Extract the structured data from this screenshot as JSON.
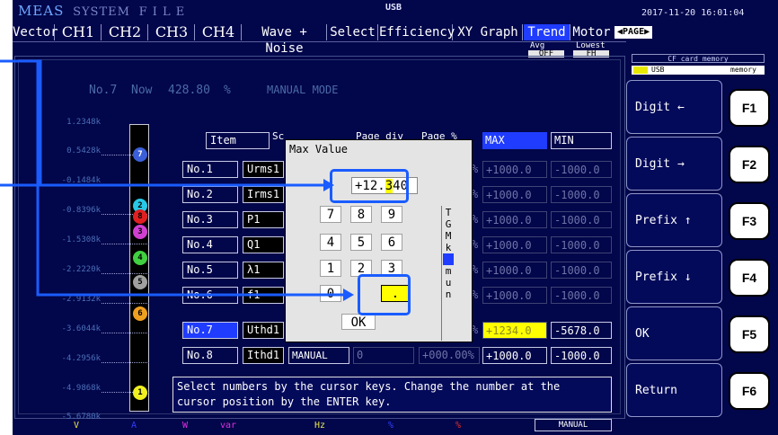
{
  "topbar": {
    "mode_meas": "MEAS",
    "mode_system": "SYSTEM",
    "mode_file": "F I L E",
    "usb": "USB",
    "datetime": "2017-11-20 16:01:04"
  },
  "tabs": [
    {
      "label": "Vector"
    },
    {
      "label": "CH1"
    },
    {
      "label": "CH2"
    },
    {
      "label": "CH3"
    },
    {
      "label": "CH4"
    },
    {
      "label": "Wave + Noise"
    },
    {
      "label": "Select"
    },
    {
      "label": "Efficiency"
    },
    {
      "label": "XY Graph"
    },
    {
      "label": "Trend"
    },
    {
      "label": "Motor"
    }
  ],
  "page_button": "◀PAGE▶",
  "sub_labels": {
    "avg": "Avg",
    "lowest": "Lowest",
    "avg_val": "OFF",
    "low_val": "FH"
  },
  "memory": {
    "cf": "CF card memory",
    "usb": "USB",
    "usb_memory": "memory"
  },
  "status": {
    "no": "No.7",
    "now": "Now",
    "value": "428.80",
    "unit": "%",
    "mode": "MANUAL MODE"
  },
  "scale_labels": [
    "1.2348k",
    "0.5428k",
    "-0.1484k",
    "-0.8396k",
    "-1.5308k",
    "-2.2220k",
    "-2.9132k",
    "-3.6044k",
    "-4.2956k",
    "-4.9868k",
    "-5.6780k"
  ],
  "channels": [
    "7",
    "2",
    "8",
    "3",
    "4",
    "5",
    "6",
    "1"
  ],
  "table": {
    "headers": {
      "item": "Item",
      "scale": "Scale",
      "page_div": "Page div",
      "page_pct": "Page %",
      "max": "MAX",
      "min": "MIN"
    },
    "rows": [
      {
        "no": "No.1",
        "item": "Urms1",
        "max": "+1000.0",
        "min": "-1000.0"
      },
      {
        "no": "No.2",
        "item": "Irms1",
        "max": "+1000.0",
        "min": "-1000.0"
      },
      {
        "no": "No.3",
        "item": "P1",
        "max": "+1000.0",
        "min": "-1000.0"
      },
      {
        "no": "No.4",
        "item": "Q1",
        "max": "+1000.0",
        "min": "-1000.0"
      },
      {
        "no": "No.5",
        "item": "λ1",
        "max": "+1000.0",
        "min": "-1000.0"
      },
      {
        "no": "No.6",
        "item": "f1",
        "max": "+1000.0",
        "min": "-1000.0"
      },
      {
        "no": "No.7",
        "item": "Uthd1",
        "max": "+1234.0",
        "min": "-5678.0"
      },
      {
        "no": "No.8",
        "item": "Ithd1",
        "scale": "MANUAL",
        "page_div": "0",
        "page_pct": "+000.00%",
        "max": "+1000.0",
        "min": "-1000.0"
      }
    ]
  },
  "popup": {
    "title": "Max Value",
    "value_prefix": "+12.",
    "value_cursor": "3",
    "value_suffix": "40",
    "keys": [
      "7",
      "8",
      "9",
      "4",
      "5",
      "6",
      "1",
      "2",
      "3",
      "0",
      "."
    ],
    "ok": "OK",
    "prefixes": [
      "T",
      "G",
      "M",
      "k",
      "",
      "m",
      "u",
      "n"
    ]
  },
  "help": {
    "line1": "Select numbers by the cursor keys. Change the number at the",
    "line2": "cursor position by the ENTER key."
  },
  "function_keys": [
    {
      "key": "F1",
      "label": "Digit ←"
    },
    {
      "key": "F2",
      "label": "Digit →"
    },
    {
      "key": "F3",
      "label": "Prefix ↑"
    },
    {
      "key": "F4",
      "label": "Prefix ↓"
    },
    {
      "key": "F5",
      "label": "OK"
    },
    {
      "key": "F6",
      "label": "Return"
    }
  ],
  "bottom_units": [
    "V",
    "A",
    "W",
    "var",
    "Hz",
    "%",
    "%"
  ],
  "bottom_mode": "MANUAL",
  "colors": {
    "screen_bg": "#02064a",
    "accent": "#1f3cff",
    "highlight": "#ffff00",
    "callout": "#1a5cff"
  }
}
